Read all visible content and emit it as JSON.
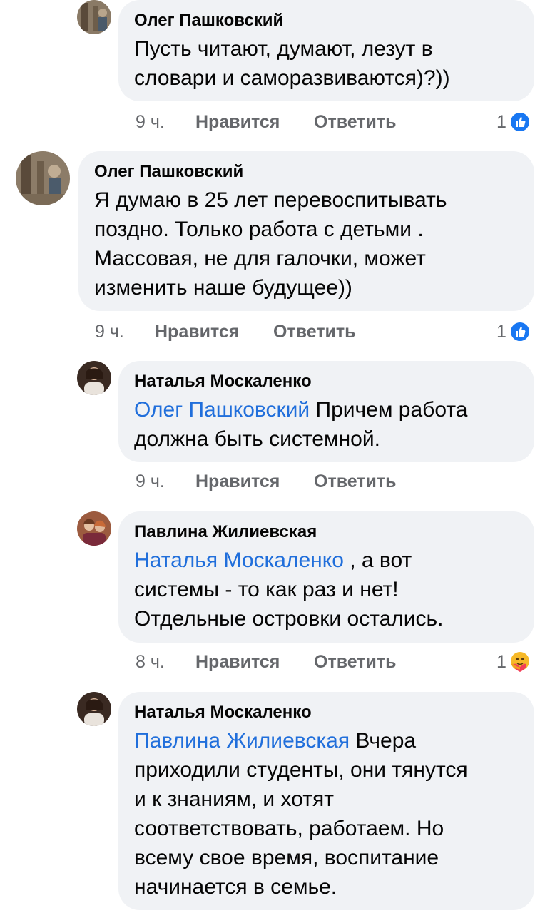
{
  "colors": {
    "bubble": "#f0f2f5",
    "mention": "#216fdb",
    "meta": "#65676b",
    "like_blue": "#1877f2",
    "care_yellow": "#f7b928"
  },
  "comments": [
    {
      "author": "Олег Пашковский",
      "text_lines": [
        "Пусть читают, думают, лезут в",
        "словари и саморазвиваются)?))"
      ],
      "time": "9 ч.",
      "like_label": "Нравится",
      "reply_label": "Ответить",
      "reaction_count": "1",
      "reaction_icon": "like-icon"
    },
    {
      "author": "Олег Пашковский",
      "text_lines": [
        "Я думаю в 25 лет перевоспитывать",
        "поздно. Только работа с детьми .",
        "Массовая, не для галочки, может",
        "изменить наше будущее))"
      ],
      "time": "9 ч.",
      "like_label": "Нравится",
      "reply_label": "Ответить",
      "reaction_count": "1",
      "reaction_icon": "like-icon"
    },
    {
      "author": "Наталья Москаленко",
      "mention": "Олег Пашковский",
      "text_first": " Причем работа",
      "text_lines": [
        "должна быть системной."
      ],
      "time": "9 ч.",
      "like_label": "Нравится",
      "reply_label": "Ответить"
    },
    {
      "author": "Павлина Жилиевская",
      "mention": "Наталья Москаленко",
      "text_first": " , а вот",
      "text_lines": [
        "системы - то как раз и нет!",
        "Отдельные островки остались."
      ],
      "time": "8 ч.",
      "like_label": "Нравится",
      "reply_label": "Ответить",
      "reaction_count": "1",
      "reaction_icon": "care-icon"
    },
    {
      "author": "Наталья Москаленко",
      "mention": "Павлина Жилиевская",
      "text_first": " Вчера",
      "text_lines": [
        "приходили студенты, они тянутся",
        "и к знаниям, и хотят",
        "соответствовать, работаем. Но",
        "всему свое время, воспитание",
        "начинается в семье."
      ]
    }
  ]
}
